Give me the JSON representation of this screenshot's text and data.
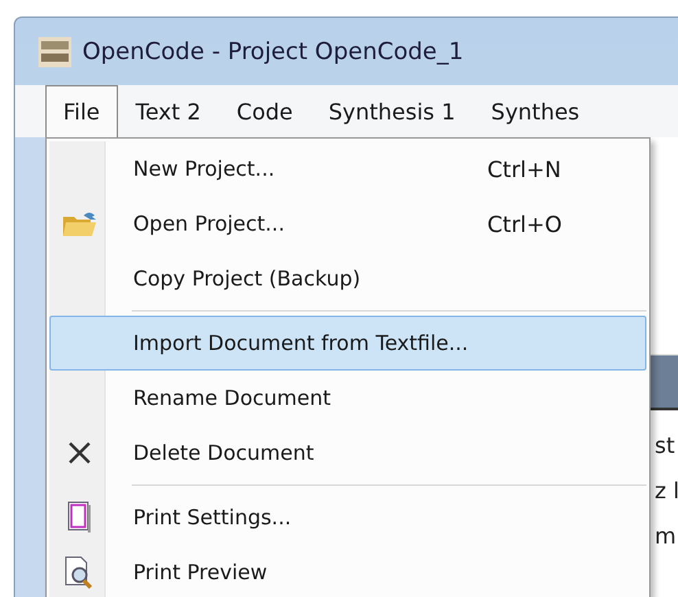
{
  "window": {
    "title": "OpenCode - Project OpenCode_1"
  },
  "menubar": [
    {
      "label": "File",
      "selected": true
    },
    {
      "label": "Text 2",
      "selected": false
    },
    {
      "label": "Code",
      "selected": false
    },
    {
      "label": "Synthesis 1",
      "selected": false
    },
    {
      "label": "Synthes",
      "selected": false
    }
  ],
  "file_menu": [
    {
      "kind": "item",
      "label": "New Project...",
      "shortcut": "Ctrl+N",
      "selected": false
    },
    {
      "kind": "item",
      "label": "Open Project...",
      "shortcut": "Ctrl+O",
      "selected": false
    },
    {
      "kind": "item",
      "label": "Copy Project (Backup)",
      "selected": false
    },
    {
      "kind": "separator"
    },
    {
      "kind": "item",
      "label": "Import Document from Textfile...",
      "selected": true
    },
    {
      "kind": "item",
      "label": "Rename Document",
      "selected": false
    },
    {
      "kind": "item",
      "label": "Delete Document",
      "selected": false
    },
    {
      "kind": "separator"
    },
    {
      "kind": "item",
      "label": "Print Settings...",
      "selected": false
    },
    {
      "kind": "item",
      "label": "Print Preview",
      "selected": false
    }
  ],
  "background_text": [
    "st",
    "z l",
    "m"
  ]
}
